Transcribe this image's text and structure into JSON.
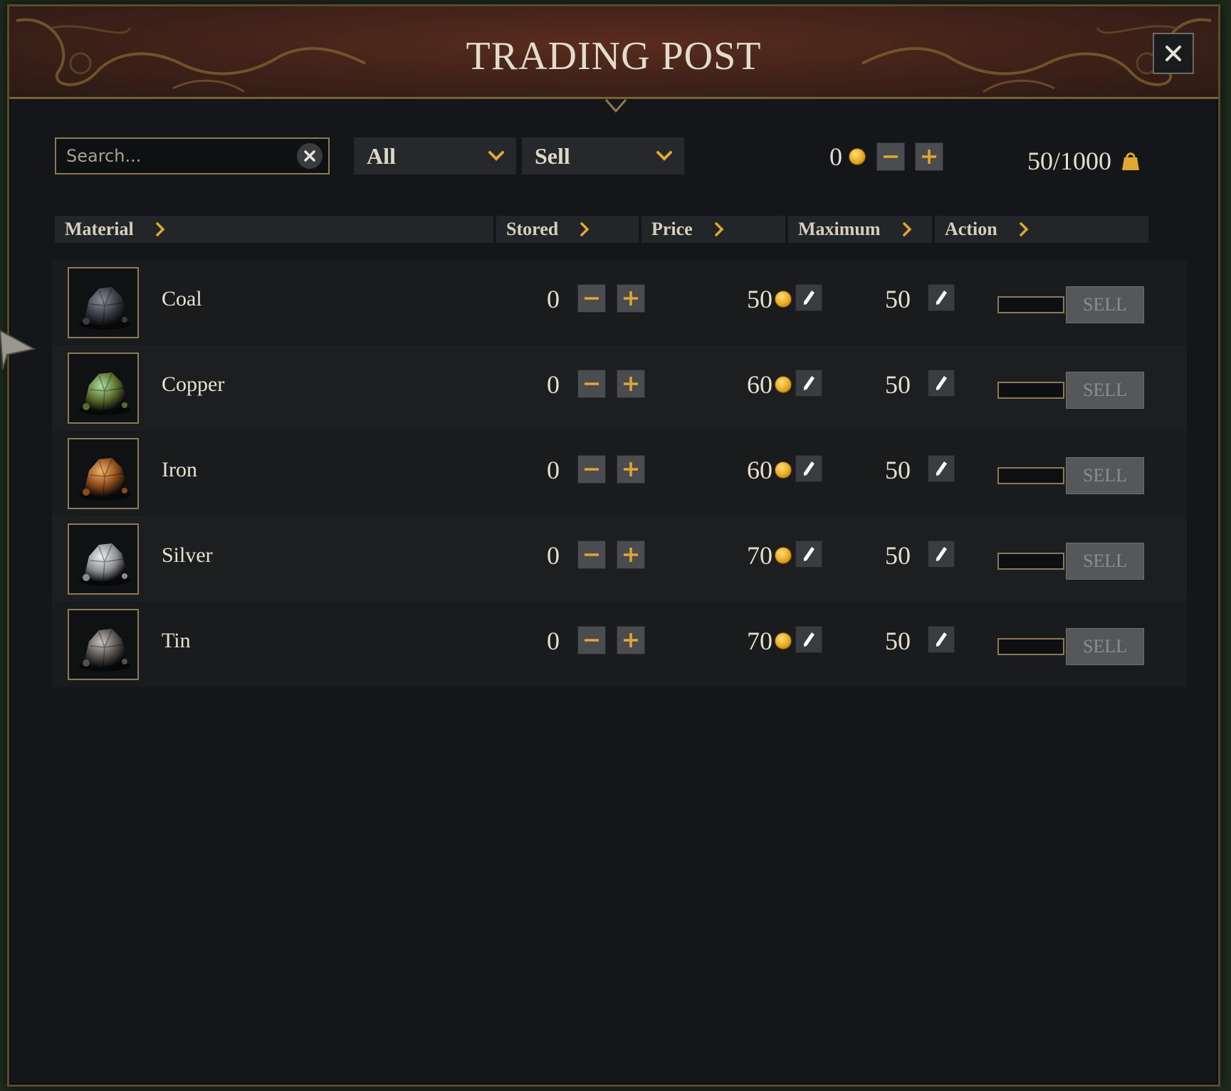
{
  "window": {
    "title": "TRADING POST",
    "close_icon": "close-icon"
  },
  "toolbar": {
    "search_placeholder": "Search...",
    "category_filter": "All",
    "mode_filter": "Sell",
    "gold_amount": "0",
    "capacity": "50/1000"
  },
  "table": {
    "columns": [
      "Material",
      "Stored",
      "Price",
      "Maximum",
      "Action"
    ],
    "rows": [
      {
        "name": "Coal",
        "stored": "0",
        "price": "50",
        "maximum": "50",
        "action": "SELL",
        "icon": "coal-ore-icon"
      },
      {
        "name": "Copper",
        "stored": "0",
        "price": "60",
        "maximum": "50",
        "action": "SELL",
        "icon": "copper-ore-icon"
      },
      {
        "name": "Iron",
        "stored": "0",
        "price": "60",
        "maximum": "50",
        "action": "SELL",
        "icon": "iron-ore-icon"
      },
      {
        "name": "Silver",
        "stored": "0",
        "price": "70",
        "maximum": "50",
        "action": "SELL",
        "icon": "silver-ore-icon"
      },
      {
        "name": "Tin",
        "stored": "0",
        "price": "70",
        "maximum": "50",
        "action": "SELL",
        "icon": "tin-ore-icon"
      }
    ]
  },
  "colors": {
    "accent_gold": "#e0a82e",
    "frame_border": "#8b7a55",
    "title_bg": "#43231a",
    "panel_bg": "#141619"
  }
}
